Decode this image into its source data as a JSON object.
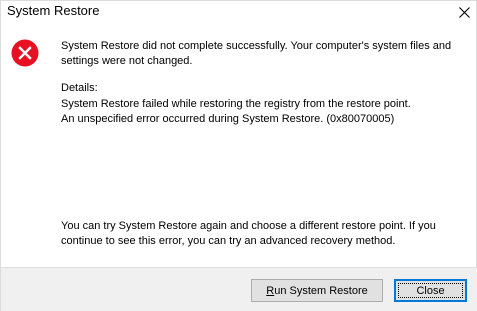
{
  "window": {
    "title": "System Restore"
  },
  "icons": {
    "error": "error-x-icon",
    "close": "close-icon"
  },
  "colors": {
    "error_red": "#e81123",
    "focus_border": "#0078d7"
  },
  "content": {
    "message": "System Restore did not complete successfully. Your computer's system files and settings were not changed.",
    "details_heading": "Details:",
    "details_lines": [
      "System Restore failed while restoring the registry from the restore point.",
      "An unspecified error occurred during System Restore. (0x80070005)"
    ],
    "advice": "You can try System Restore again and choose a different restore point. If you continue to see this error, you can try an advanced recovery method."
  },
  "buttons": {
    "run_mnemonic": "R",
    "run_rest": "un System Restore",
    "close_label": "Close"
  }
}
